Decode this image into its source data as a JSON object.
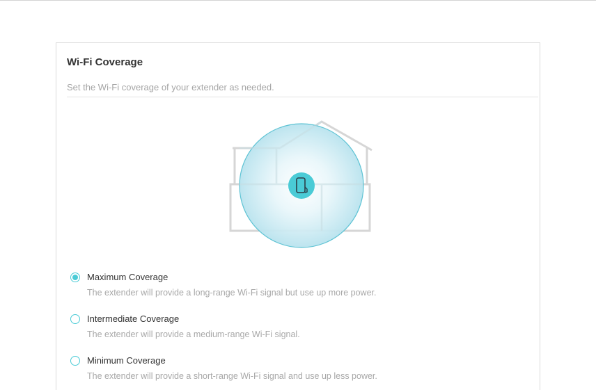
{
  "panel": {
    "title": "Wi-Fi Coverage",
    "subtitle": "Set the Wi-Fi coverage of your extender as needed."
  },
  "illustration": {
    "icon": "house-coverage-illustration",
    "device_icon": "extender-device-icon",
    "coverage_color": "#bde6f0",
    "accent_color": "#4acbd6",
    "house_color": "#d6d6d6"
  },
  "coverage_options": [
    {
      "label": "Maximum Coverage",
      "description": "The extender will provide a long-range Wi-Fi signal but use up more power.",
      "selected": true
    },
    {
      "label": "Intermediate Coverage",
      "description": "The extender will provide a medium-range Wi-Fi signal.",
      "selected": false
    },
    {
      "label": "Minimum Coverage",
      "description": "The extender will provide a short-range Wi-Fi signal and use up less power.",
      "selected": false
    }
  ]
}
